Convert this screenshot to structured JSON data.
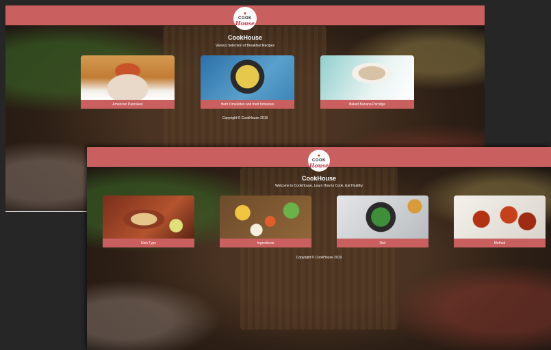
{
  "window1": {
    "logo": {
      "top": "COOK",
      "bottom": "House"
    },
    "title": "CookHouse",
    "tagline": "Various Selection of Breakfast Recipes",
    "cards": [
      {
        "label": "American Pancakes"
      },
      {
        "label": "Herb Omelettes and fried tomatoes"
      },
      {
        "label": "Baked Banana Porridge"
      }
    ],
    "copyright": "Copyright © CookHouse 2019"
  },
  "window2": {
    "logo": {
      "top": "COOK",
      "bottom": "House"
    },
    "title": "CookHouse",
    "tagline": "Welcome to CookHouse, Learn How to Cook, Eat Healthy",
    "cards": [
      {
        "label": "Dish Type"
      },
      {
        "label": "Ingredients"
      },
      {
        "label": "Diet"
      },
      {
        "label": "Method"
      }
    ],
    "copyright": "Copyright © CookHouse 2019"
  },
  "colors": {
    "header": "#c9605f",
    "caption": "#c9605f"
  },
  "icons": {
    "logo": "heart-icon"
  }
}
